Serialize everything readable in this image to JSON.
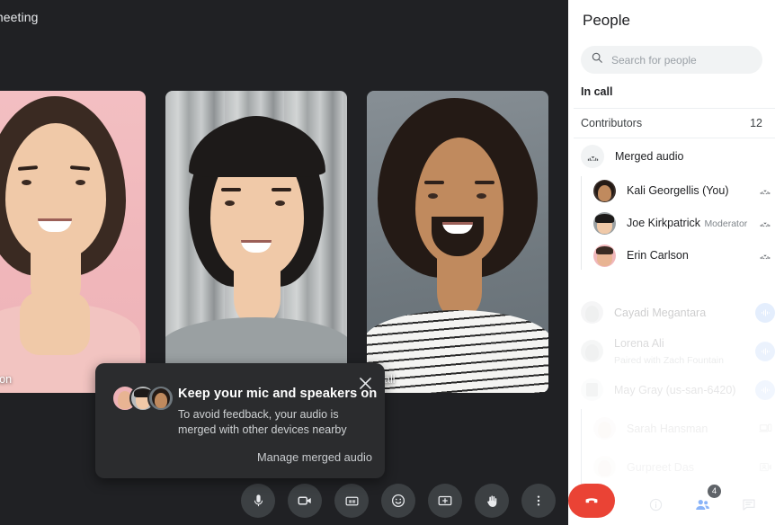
{
  "meeting": {
    "title": "meeting"
  },
  "tiles": [
    {
      "name": "Carlson",
      "bg": "bg-pink",
      "skin": "skin-b"
    },
    {
      "name": "",
      "bg": "bg-curtain",
      "skin": "skin-b"
    },
    {
      "name": "Hall",
      "bg": "bg-slate",
      "skin": "skin-c"
    }
  ],
  "toast": {
    "title": "Keep your mic and speakers on",
    "body": "To avoid feedback, your audio is merged with other devices nearby",
    "action": "Manage merged audio",
    "close_icon": "close-icon",
    "avatar_count": 3
  },
  "controls": [
    {
      "name": "microphone-button",
      "icon": "microphone-icon",
      "label": "Microphone"
    },
    {
      "name": "camera-button",
      "icon": "video-camera-icon",
      "label": "Camera"
    },
    {
      "name": "captions-button",
      "icon": "closed-captions-icon",
      "label": "Captions"
    },
    {
      "name": "reactions-button",
      "icon": "emoji-smile-icon",
      "label": "Reactions"
    },
    {
      "name": "present-button",
      "icon": "present-screen-icon",
      "label": "Present now"
    },
    {
      "name": "raise-hand-button",
      "icon": "raised-hand-icon",
      "label": "Raise hand"
    },
    {
      "name": "more-options-button",
      "icon": "more-vertical-icon",
      "label": "More options"
    },
    {
      "name": "leave-call-button",
      "icon": "phone-hangup-icon",
      "label": "Leave call"
    }
  ],
  "right_bar": {
    "info_label": "Meeting details",
    "people_label": "People",
    "chat_label": "Chat with everyone",
    "people_badge": "4",
    "accent": "#8ab4f8"
  },
  "panel": {
    "title": "People",
    "search": {
      "placeholder": "Search for people",
      "value": "",
      "icon": "search-icon"
    },
    "in_call_label": "In call",
    "contributors": {
      "label": "Contributors",
      "count": "12"
    },
    "merged_audio": {
      "label": "Merged audio",
      "icon": "merged-audio-icon"
    },
    "merged_members": [
      {
        "name": "Kali Georgellis (You)",
        "sub": "",
        "right_icon": "merged-audio-icon",
        "avatar": "skin-c"
      },
      {
        "name": "Joe Kirkpatrick",
        "sub": "Moderator",
        "right_icon": "merged-audio-icon",
        "avatar": "skin-b"
      },
      {
        "name": "Erin Carlson",
        "sub": "",
        "right_icon": "merged-audio-icon",
        "avatar": "skin-b"
      }
    ],
    "other_members": [
      {
        "name": "Cayadi Megantara",
        "sub": "",
        "right_icon": "audio-waveform-icon",
        "fade": "fade-1",
        "indent": false
      },
      {
        "name": "Lorena Ali",
        "sub": "Paired with  Zach Fountain",
        "right_icon": "audio-waveform-icon",
        "fade": "fade-2",
        "indent": false
      },
      {
        "name": "May Gray (us-san-6420)",
        "sub": "",
        "right_icon": "audio-waveform-icon",
        "fade": "fade-3",
        "indent": false
      },
      {
        "name": "Sarah Hansman",
        "sub": "",
        "right_icon": "device-pair-icon",
        "fade": "fade-4",
        "indent": true
      },
      {
        "name": "Gurpreet Das",
        "sub": "",
        "right_icon": "presenting-camera-icon",
        "fade": "fade-5",
        "indent": true
      }
    ]
  }
}
